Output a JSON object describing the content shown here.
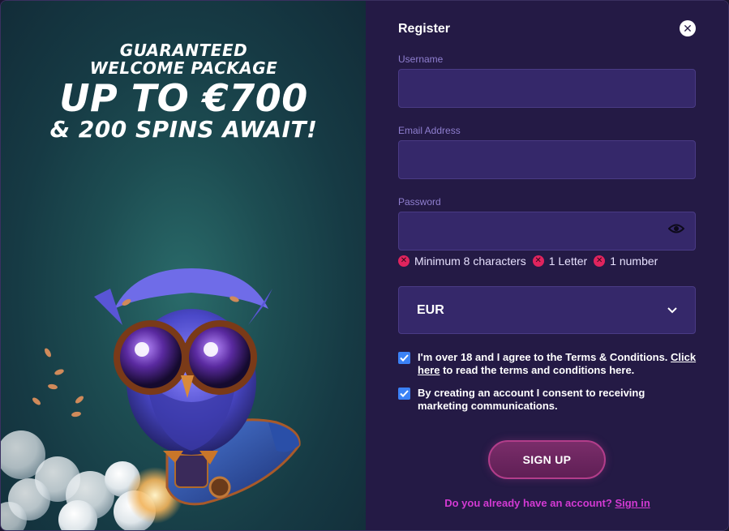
{
  "promo": {
    "line1": "GUARANTEED",
    "line2": "WELCOME PACKAGE",
    "line3": "UP TO €700",
    "line4": "& 200 SPINS AWAIT!"
  },
  "form": {
    "title": "Register",
    "username_label": "Username",
    "username_value": "",
    "email_label": "Email Address",
    "email_value": "",
    "password_label": "Password",
    "password_value": "",
    "rules": [
      {
        "label": "Minimum 8 characters",
        "icon": "x-circle-icon"
      },
      {
        "label": "1 Letter",
        "icon": "x-circle-icon"
      },
      {
        "label": "1 number",
        "icon": "x-circle-icon"
      }
    ],
    "currency_value": "EUR",
    "terms": {
      "checked": true,
      "text_before": "I'm over 18 and I agree to the Terms & Conditions. ",
      "link": "Click here",
      "text_after": " to read the terms and conditions here."
    },
    "marketing": {
      "checked": true,
      "text": "By creating an account I consent to receiving marketing communications."
    },
    "signup_label": "SIGN UP",
    "signin_prompt": "Do you already have an account? ",
    "signin_link": "Sign in"
  },
  "colors": {
    "panel_bg": "#241a45",
    "field_bg": "#35286a",
    "accent_pink": "#d33ad3",
    "error_red": "#e0245e",
    "checkbox_blue": "#3b82f6"
  }
}
